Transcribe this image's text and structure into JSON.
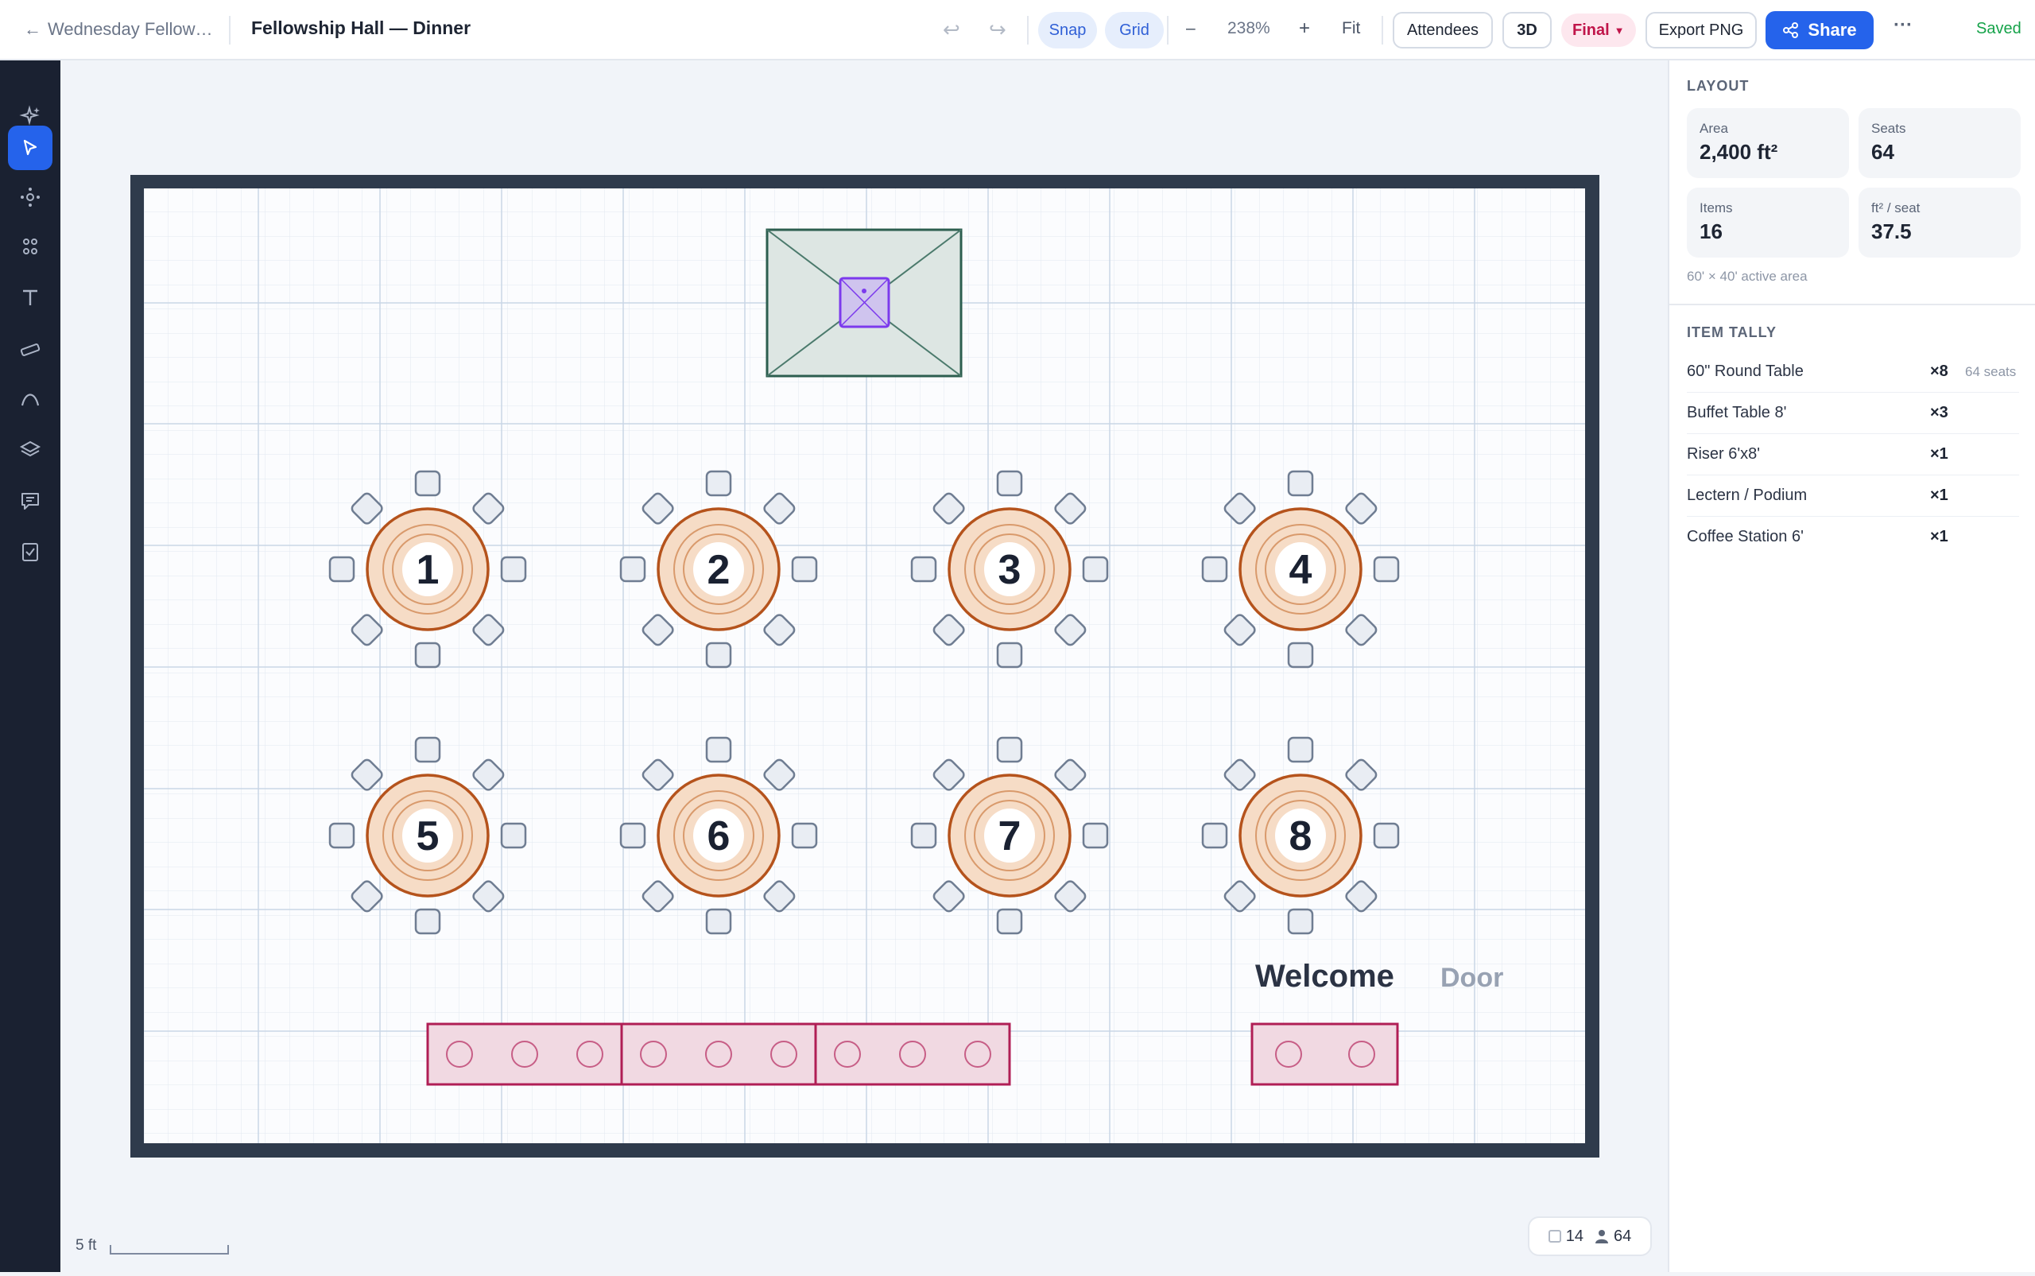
{
  "header": {
    "back_label": "Wednesday Fellow…",
    "doc_title": "Fellowship Hall — Dinner",
    "undo_icon": "undo-icon",
    "redo_icon": "redo-icon",
    "snap_label": "Snap",
    "grid_label": "Grid",
    "zoom_out_label": "–",
    "zoom_value": "238%",
    "zoom_in_label": "+",
    "fit_label": "Fit",
    "attendees_label": "Attendees",
    "view3d_label": "3D",
    "status_label": "Final",
    "export_label": "Export PNG",
    "share_label": "Share",
    "more_label": "···",
    "saved_label": "Saved"
  },
  "sidebar": {
    "tools": [
      "sparkle-icon",
      "cursor-icon",
      "node-icon",
      "apps-icon",
      "text-icon",
      "ruler-icon",
      "curve-icon",
      "layers-icon",
      "comment-icon",
      "checklist-icon"
    ],
    "active_index": 1
  },
  "canvas": {
    "tables": [
      {
        "number": "1"
      },
      {
        "number": "2"
      },
      {
        "number": "3"
      },
      {
        "number": "4"
      },
      {
        "number": "5"
      },
      {
        "number": "6"
      },
      {
        "number": "7"
      },
      {
        "number": "8"
      }
    ],
    "welcome_label": "Welcome",
    "door_label": "Door",
    "colors": {
      "wall": "#2f3b4c",
      "table_stroke": "#b5531c",
      "table_fill": "#f6dcc6",
      "buffet": "#b01e55",
      "riser": "#2c5e4f",
      "lectern": "#7c3aed"
    },
    "scale_label": "5 ft",
    "counter_items": "14",
    "counter_people": "64"
  },
  "panel": {
    "layout_title": "LAYOUT",
    "stats": [
      {
        "label": "Area",
        "value": "2,400 ft²"
      },
      {
        "label": "Seats",
        "value": "64"
      },
      {
        "label": "Items",
        "value": "16"
      },
      {
        "label": "ft² / seat",
        "value": "37.5"
      }
    ],
    "active_area_note": "60' × 40' active area",
    "tally_title": "ITEM TALLY",
    "tally": [
      {
        "name": "60\" Round Table",
        "qty": "×8",
        "extra": "64 seats"
      },
      {
        "name": "Buffet Table 8'",
        "qty": "×3",
        "extra": ""
      },
      {
        "name": "Riser 6'x8'",
        "qty": "×1",
        "extra": ""
      },
      {
        "name": "Lectern / Podium",
        "qty": "×1",
        "extra": ""
      },
      {
        "name": "Coffee Station 6'",
        "qty": "×1",
        "extra": ""
      }
    ]
  }
}
